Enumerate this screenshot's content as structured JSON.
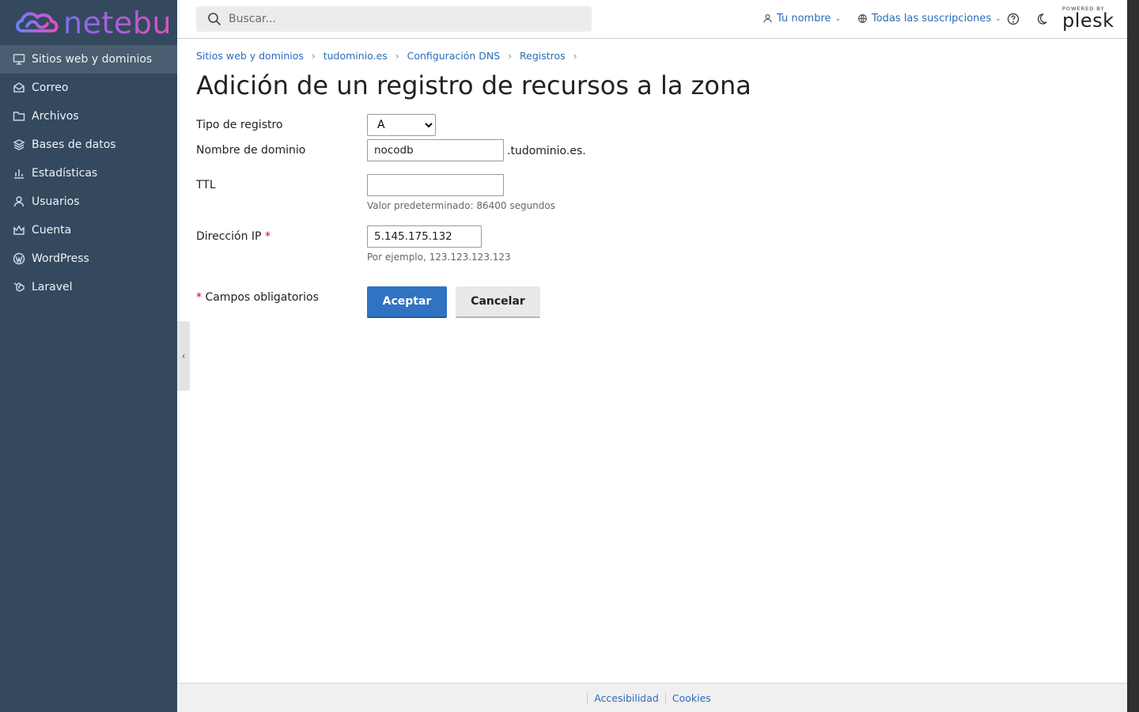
{
  "brand": {
    "name": "netebu",
    "logo_icon": "cloud-infinity-icon"
  },
  "sidebar": {
    "items": [
      {
        "label": "Sitios web y dominios",
        "icon": "monitor-icon",
        "active": true
      },
      {
        "label": "Correo",
        "icon": "envelope-icon"
      },
      {
        "label": "Archivos",
        "icon": "folder-icon"
      },
      {
        "label": "Bases de datos",
        "icon": "database-layers-icon"
      },
      {
        "label": "Estadísticas",
        "icon": "bar-chart-icon"
      },
      {
        "label": "Usuarios",
        "icon": "user-icon"
      },
      {
        "label": "Cuenta",
        "icon": "crown-icon"
      },
      {
        "label": "WordPress",
        "icon": "wordpress-icon"
      },
      {
        "label": "Laravel",
        "icon": "laravel-icon"
      }
    ]
  },
  "header": {
    "search_placeholder": "Buscar...",
    "user_label": "Tu nombre",
    "subscriptions_label": "Todas las suscripciones",
    "powered_by": "POWERED BY",
    "plesk": "plesk"
  },
  "breadcrumb": [
    "Sitios web y dominios",
    "tudominio.es",
    "Configuración DNS",
    "Registros"
  ],
  "page": {
    "title": "Adición de un registro de recursos a la zona"
  },
  "form": {
    "record_type_label": "Tipo de registro",
    "record_type_value": "A",
    "domain_name_label": "Nombre de dominio",
    "domain_name_value": "nocodb",
    "domain_suffix": ".tudominio.es.",
    "ttl_label": "TTL",
    "ttl_value": "",
    "ttl_hint": "Valor predeterminado: 86400 segundos",
    "ip_label": "Dirección IP",
    "ip_value": "5.145.175.132",
    "ip_hint": "Por ejemplo, 123.123.123.123",
    "required_marker": "*",
    "required_note": "Campos obligatorios",
    "accept_label": "Aceptar",
    "cancel_label": "Cancelar"
  },
  "footer": {
    "links": [
      "Accesibilidad",
      "Cookies"
    ]
  },
  "colors": {
    "sidebar_bg": "#34495e",
    "link": "#2b6cb8",
    "primary_button": "#2f73c2",
    "required": "#d0021b"
  }
}
